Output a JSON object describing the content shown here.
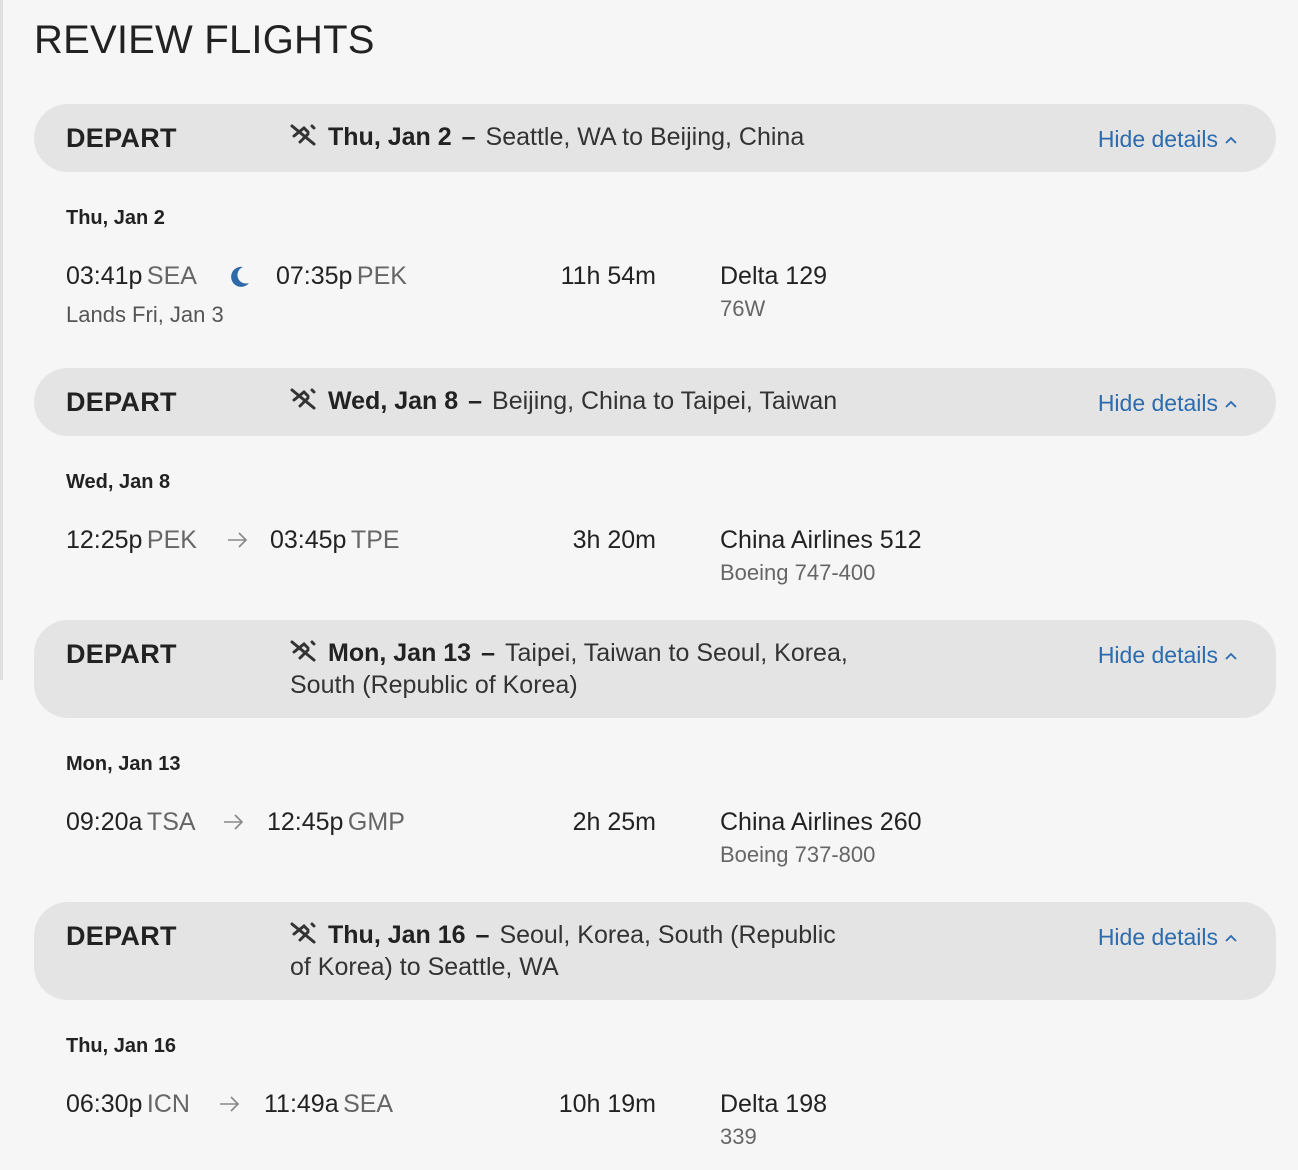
{
  "page_title": "REVIEW FLIGHTS",
  "segments": [
    {
      "label": "DEPART",
      "date": "Thu, Jan 2",
      "dash": "–",
      "route_line1": "Seattle, WA to Beijing, China",
      "route_line2": "",
      "hide_details": "Hide details",
      "flight": {
        "date": "Thu, Jan 2",
        "dep_time": "03:41p",
        "dep_code": "SEA",
        "separator_icon": "moon-icon",
        "arr_time": "07:35p",
        "arr_code": "PEK",
        "lands_note": "Lands Fri, Jan 3",
        "duration": "11h 54m",
        "airline": "Delta 129",
        "aircraft": "76W"
      }
    },
    {
      "label": "DEPART",
      "date": "Wed, Jan 8",
      "dash": "–",
      "route_line1": "Beijing, China to Taipei, Taiwan",
      "route_line2": "",
      "hide_details": "Hide details",
      "flight": {
        "date": "Wed, Jan 8",
        "dep_time": "12:25p",
        "dep_code": "PEK",
        "separator_icon": "arrow-right-icon",
        "arr_time": "03:45p",
        "arr_code": "TPE",
        "lands_note": "",
        "duration": "3h 20m",
        "airline": "China Airlines 512",
        "aircraft": "Boeing 747-400"
      }
    },
    {
      "label": "DEPART",
      "date": "Mon, Jan 13",
      "dash": "–",
      "route_line1": "Taipei, Taiwan to Seoul, Korea,",
      "route_line2": "South (Republic of Korea)",
      "hide_details": "Hide details",
      "flight": {
        "date": "Mon, Jan 13",
        "dep_time": "09:20a",
        "dep_code": "TSA",
        "separator_icon": "arrow-right-icon",
        "arr_time": "12:45p",
        "arr_code": "GMP",
        "lands_note": "",
        "duration": "2h 25m",
        "airline": "China Airlines 260",
        "aircraft": "Boeing 737-800"
      }
    },
    {
      "label": "DEPART",
      "date": "Thu, Jan 16",
      "dash": "–",
      "route_line1": "Seoul, Korea, South (Republic",
      "route_line2": "of Korea) to Seattle, WA",
      "hide_details": "Hide details",
      "flight": {
        "date": "Thu, Jan 16",
        "dep_time": "06:30p",
        "dep_code": "ICN",
        "separator_icon": "arrow-right-icon",
        "arr_time": "11:49a",
        "arr_code": "SEA",
        "lands_note": "",
        "duration": "10h 19m",
        "airline": "Delta 198",
        "aircraft": "339"
      }
    }
  ]
}
